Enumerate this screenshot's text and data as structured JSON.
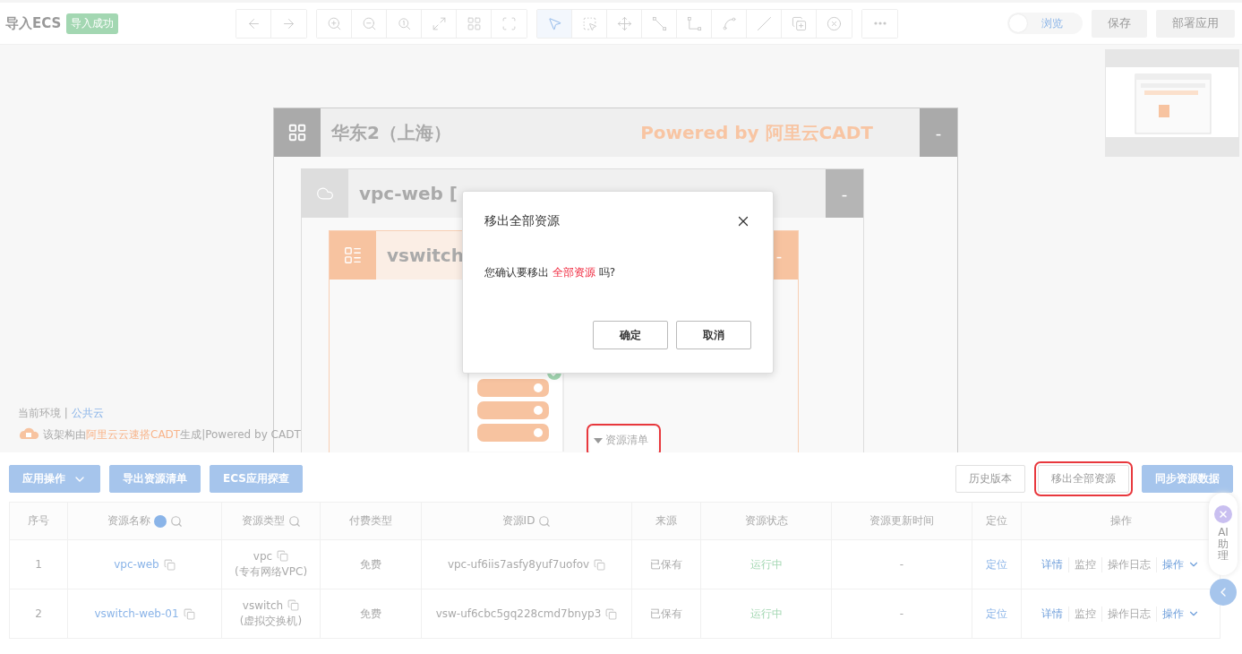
{
  "header": {
    "title": "导入ECS",
    "badge": "导入成功"
  },
  "tool_groups": [
    {
      "tools": [
        {
          "kind": "back",
          "selected": false
        },
        {
          "kind": "forward",
          "selected": false
        }
      ]
    },
    {
      "tools": [
        {
          "kind": "zoom-in",
          "selected": false
        },
        {
          "kind": "zoom-out",
          "selected": false
        },
        {
          "kind": "zoom-reset",
          "selected": false
        },
        {
          "kind": "fit",
          "selected": false
        },
        {
          "kind": "grid",
          "selected": false
        },
        {
          "kind": "fullscreen",
          "selected": false
        }
      ]
    },
    {
      "tools": [
        {
          "kind": "pointer",
          "selected": true
        },
        {
          "kind": "box-select",
          "selected": false
        },
        {
          "kind": "move",
          "selected": false
        },
        {
          "kind": "line-link",
          "selected": false
        },
        {
          "kind": "elbow-link",
          "selected": false
        },
        {
          "kind": "curve-link",
          "selected": false
        },
        {
          "kind": "line",
          "selected": false
        },
        {
          "kind": "add-layer",
          "selected": false
        },
        {
          "kind": "remove",
          "selected": false
        }
      ]
    },
    {
      "tools": [
        {
          "kind": "more",
          "selected": false
        }
      ]
    }
  ],
  "view_toggle": {
    "label": "浏览",
    "on": false
  },
  "actions": [
    {
      "label": "保存",
      "disabled": true
    },
    {
      "label": "部署应用",
      "disabled": true
    }
  ],
  "canvas": {
    "region": {
      "title": "华东2（上海）",
      "watermark": "Powered by 阿里云CADT",
      "collapse": "-"
    },
    "vpc": {
      "title": "vpc-web [",
      "collapse": "-"
    },
    "vswitch": {
      "title": "vswitch",
      "collapse": "-"
    },
    "footer": {
      "env_label": "当前环境 | ",
      "env_value": "公共云",
      "credit_prefix": "该架构由",
      "credit_link": "阿里云云速搭CADT",
      "credit_suffix": "生成|Powered by CADT"
    },
    "resource_tab": {
      "label": "资源清单",
      "highlighted": true
    }
  },
  "left_buttons": [
    {
      "label": "应用操作",
      "kind": "dropdown"
    },
    {
      "label": "导出资源清单",
      "kind": "plain"
    },
    {
      "label": "ECS应用探查",
      "kind": "plain"
    }
  ],
  "right_buttons": [
    {
      "label": "历史版本",
      "kind": "outline",
      "highlighted": false
    },
    {
      "label": "移出全部资源",
      "kind": "outline",
      "highlighted": true
    },
    {
      "label": "同步资源数据",
      "kind": "primary",
      "highlighted": false
    }
  ],
  "table": {
    "columns": [
      {
        "label": "序号",
        "help": false,
        "search": false
      },
      {
        "label": "资源名称",
        "help": true,
        "search": true
      },
      {
        "label": "资源类型",
        "help": false,
        "search": true
      },
      {
        "label": "付费类型",
        "help": false,
        "search": false
      },
      {
        "label": "资源ID",
        "help": false,
        "search": true
      },
      {
        "label": "来源",
        "help": false,
        "search": false
      },
      {
        "label": "资源状态",
        "help": false,
        "search": false
      },
      {
        "label": "资源更新时间",
        "help": false,
        "search": false
      },
      {
        "label": "定位",
        "help": false,
        "search": false
      },
      {
        "label": "操作",
        "help": false,
        "search": false
      }
    ],
    "rows": [
      {
        "index": "1",
        "name": "vpc-web",
        "type": "vpc",
        "type_note": "(专有网络VPC)",
        "billing": "免费",
        "id": "vpc-uf6iis7asfy8yuf7uofov",
        "source": "已保有",
        "status": "运行中",
        "updated": "-",
        "locate": "定位",
        "ops": [
          {
            "label": "详情",
            "kind": "link",
            "disabled": false
          },
          {
            "label": "监控",
            "kind": "link",
            "disabled": true
          },
          {
            "label": "操作日志",
            "kind": "link",
            "disabled": true
          },
          {
            "label": "操作",
            "kind": "dropdown",
            "disabled": false
          }
        ]
      },
      {
        "index": "2",
        "name": "vswitch-web-01",
        "type": "vswitch",
        "type_note": "(虚拟交换机)",
        "billing": "免费",
        "id": "vsw-uf6cbc5gq228cmd7bnyp3",
        "source": "已保有",
        "status": "运行中",
        "updated": "-",
        "locate": "定位",
        "ops": [
          {
            "label": "详情",
            "kind": "link",
            "disabled": false
          },
          {
            "label": "监控",
            "kind": "link",
            "disabled": true
          },
          {
            "label": "操作日志",
            "kind": "link",
            "disabled": true
          },
          {
            "label": "操作",
            "kind": "dropdown",
            "disabled": false
          }
        ]
      }
    ]
  },
  "assistant": {
    "label": "AI助理"
  },
  "dialog": {
    "title": "移出全部资源",
    "message": "您确认要移出 **全部资源** 吗?",
    "buttons": [
      "确定",
      "取消"
    ]
  }
}
